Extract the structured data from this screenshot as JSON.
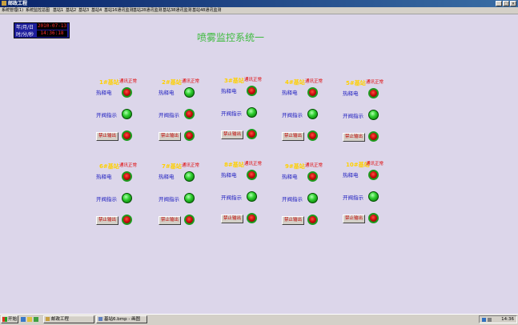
{
  "window": {
    "title": "邮政工程"
  },
  "menu": [
    "系统管理(1)",
    "系统监控总图",
    "基站1",
    "基站2",
    "基站3",
    "基站4",
    "基站16通讯监测",
    "基站28通讯监测",
    "基站38通讯监测",
    "基站48通讯监测"
  ],
  "clock": {
    "date_label": "年/月/日",
    "date_value": "2010-07-13",
    "time_label": "时/分/秒",
    "time_value": "14:36:18"
  },
  "system_title": "喷雾监控系统一",
  "labels": {
    "comm_ok": "通讯正常",
    "heat_release": "热释电",
    "valve_indicator": "开阀指示",
    "disable_output": "禁止输出"
  },
  "stations": [
    {
      "name": "1#基站"
    },
    {
      "name": "2#基站"
    },
    {
      "name": "3#基站"
    },
    {
      "name": "4#基站"
    },
    {
      "name": "5#基站"
    },
    {
      "name": "6#基站"
    },
    {
      "name": "7#基站"
    },
    {
      "name": "8#基站"
    },
    {
      "name": "9#基站"
    },
    {
      "name": "10#基站"
    }
  ],
  "taskbar": {
    "start": "开始",
    "tasks": [
      "邮政工程",
      "基站6.bmp - 画图"
    ],
    "time": "14:36"
  },
  "colors": {
    "titlebar": "#0a246a",
    "background": "#dcd6ea",
    "title_green": "#3dbb3d",
    "station_yellow": "#ffd000",
    "label_blue": "#2020c0",
    "alarm_red": "#d01010",
    "ok_green": "#30d030"
  }
}
